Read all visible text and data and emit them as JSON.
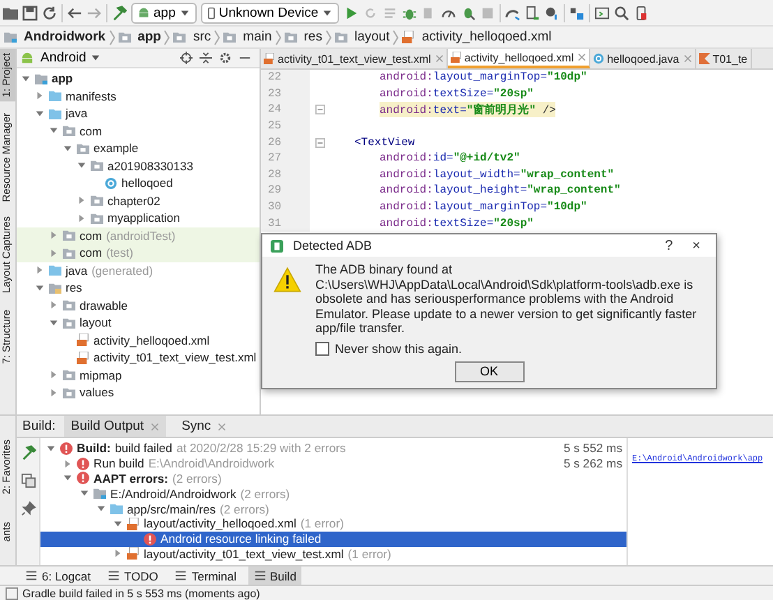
{
  "toolbar": {
    "config": "app",
    "device": "Unknown Device"
  },
  "breadcrumb": [
    "Androidwork",
    "app",
    "src",
    "main",
    "res",
    "layout",
    "activity_helloqoed.xml"
  ],
  "side_tools_top": [
    {
      "label": "1: Project",
      "selected": true
    },
    {
      "label": "Resource Manager",
      "selected": false
    },
    {
      "label": "Layout Captures",
      "selected": false
    },
    {
      "label": "7: Structure",
      "selected": false
    }
  ],
  "project": {
    "view": "Android",
    "tree": [
      {
        "label": "app",
        "kind": "module",
        "expanded": true,
        "children": [
          {
            "label": "manifests",
            "kind": "folder",
            "expanded": false
          },
          {
            "label": "java",
            "kind": "folder",
            "expanded": true,
            "children": [
              {
                "label": "com",
                "kind": "package",
                "expanded": true,
                "children": [
                  {
                    "label": "example",
                    "kind": "package",
                    "expanded": true,
                    "children": [
                      {
                        "label": "a201908330133",
                        "kind": "package",
                        "expanded": true,
                        "children": [
                          {
                            "label": "helloqoed",
                            "kind": "class"
                          }
                        ]
                      },
                      {
                        "label": "chapter02",
                        "kind": "package",
                        "expanded": false
                      },
                      {
                        "label": "myapplication",
                        "kind": "package",
                        "expanded": false
                      }
                    ]
                  }
                ]
              },
              {
                "label": "com",
                "detail": "(androidTest)",
                "kind": "package",
                "expanded": false,
                "test": true
              },
              {
                "label": "com",
                "detail": "(test)",
                "kind": "package",
                "expanded": false,
                "test": true
              }
            ]
          },
          {
            "label": "java",
            "detail": "(generated)",
            "kind": "folder",
            "expanded": false
          },
          {
            "label": "res",
            "kind": "res",
            "expanded": true,
            "children": [
              {
                "label": "drawable",
                "kind": "package",
                "expanded": false
              },
              {
                "label": "layout",
                "kind": "package",
                "expanded": true,
                "children": [
                  {
                    "label": "activity_helloqoed.xml",
                    "kind": "xml"
                  },
                  {
                    "label": "activity_t01_text_view_test.xml",
                    "kind": "xml"
                  }
                ]
              },
              {
                "label": "mipmap",
                "kind": "package",
                "expanded": false
              },
              {
                "label": "values",
                "kind": "package",
                "expanded": false
              }
            ]
          }
        ]
      }
    ]
  },
  "editor_tabs": [
    {
      "label": "activity_t01_text_view_test.xml",
      "kind": "xml",
      "selected": false
    },
    {
      "label": "activity_helloqoed.xml",
      "kind": "xml",
      "selected": true
    },
    {
      "label": "helloqoed.java",
      "kind": "class",
      "selected": false
    },
    {
      "label": "T01_te",
      "kind": "kotlin",
      "selected": false
    }
  ],
  "code": [
    {
      "num": "22",
      "kind": "attr",
      "ns": "android:",
      "attr": "layout_marginTop=",
      "value": "\"10dp\""
    },
    {
      "num": "23",
      "kind": "attr",
      "ns": "android:",
      "attr": "textSize=",
      "value": "\"20sp\""
    },
    {
      "num": "24",
      "kind": "attr",
      "ns": "android:",
      "attr": "text=",
      "value": "\"窗前明月光\"",
      "end": " />",
      "highlighted": true
    },
    {
      "num": "25",
      "kind": "blank"
    },
    {
      "num": "26",
      "kind": "tag",
      "tag": "<TextView"
    },
    {
      "num": "27",
      "kind": "attr",
      "ns": "android:",
      "attr": "id=",
      "value": "\"@+id/tv2\""
    },
    {
      "num": "28",
      "kind": "attr",
      "ns": "android:",
      "attr": "layout_width=",
      "value": "\"wrap_content\""
    },
    {
      "num": "29",
      "kind": "attr",
      "ns": "android:",
      "attr": "layout_height=",
      "value": "\"wrap_content\""
    },
    {
      "num": "30",
      "kind": "attr",
      "ns": "android:",
      "attr": "layout_marginTop=",
      "value": "\"10dp\""
    },
    {
      "num": "31",
      "kind": "attr",
      "ns": "android:",
      "attr": "textSize=",
      "value": "\"20sp\""
    }
  ],
  "dialog": {
    "title": "Detected ADB",
    "help": "?",
    "close": "×",
    "message": "The ADB binary found at C:\\Users\\WHJ\\AppData\\Local\\Android\\Sdk\\platform-tools\\adb.exe is obsolete and has seriousperformance problems with the Android Emulator. Please update to a newer version to get significantly faster app/file transfer.",
    "checkbox": {
      "label": "Never show this again.",
      "checked": false
    },
    "ok": "OK"
  },
  "side_tools_bottom": [
    {
      "label": "2: Favorites"
    },
    {
      "label": "ants"
    }
  ],
  "build": {
    "label": "Build:",
    "tabs": [
      {
        "label": "Build Output",
        "selected": true
      },
      {
        "label": "Sync",
        "selected": false
      }
    ],
    "tree": [
      {
        "label": "Build:",
        "rest": "build failed",
        "detail": "at 2020/2/28 15:29  with 2 errors",
        "time": "5 s 552 ms",
        "kind": "error",
        "bold": true,
        "expanded": true,
        "selected": false,
        "children": [
          {
            "label": "Run build",
            "detail": "E:\\Android\\Androidwork",
            "time": "5 s 262 ms",
            "kind": "error",
            "bold": false,
            "expanded": false,
            "selected": false
          },
          {
            "label": "AAPT errors:",
            "detail": "(2 errors)",
            "kind": "error",
            "bold": true,
            "expanded": true,
            "selected": false,
            "children": [
              {
                "label": "E:/Android/Androidwork",
                "detail": "(2 errors)",
                "kind": "module",
                "bold": false,
                "expanded": true,
                "selected": false,
                "children": [
                  {
                    "label": "app/src/main/res",
                    "detail": "(2 errors)",
                    "kind": "folder",
                    "bold": false,
                    "expanded": true,
                    "selected": false,
                    "children": [
                      {
                        "label": "layout/activity_helloqoed.xml",
                        "detail": "(1 error)",
                        "kind": "xml",
                        "bold": false,
                        "expanded": true,
                        "selected": false,
                        "children": [
                          {
                            "label": "Android resource linking failed",
                            "kind": "error",
                            "bold": false,
                            "selected": true
                          }
                        ]
                      },
                      {
                        "label": "layout/activity_t01_text_view_test.xml",
                        "detail": "(1 error)",
                        "kind": "xml",
                        "bold": false,
                        "expanded": false,
                        "selected": false
                      }
                    ]
                  }
                ]
              }
            ]
          }
        ]
      }
    ],
    "link": "E:\\Android\\Androidwork\\app"
  },
  "bottom_tabs": [
    {
      "label": "6: Logcat",
      "selected": false
    },
    {
      "label": "TODO",
      "selected": false
    },
    {
      "label": "Terminal",
      "selected": false
    },
    {
      "label": "Build",
      "selected": true
    }
  ],
  "status": "Gradle build failed in 5 s 553 ms (moments ago)"
}
